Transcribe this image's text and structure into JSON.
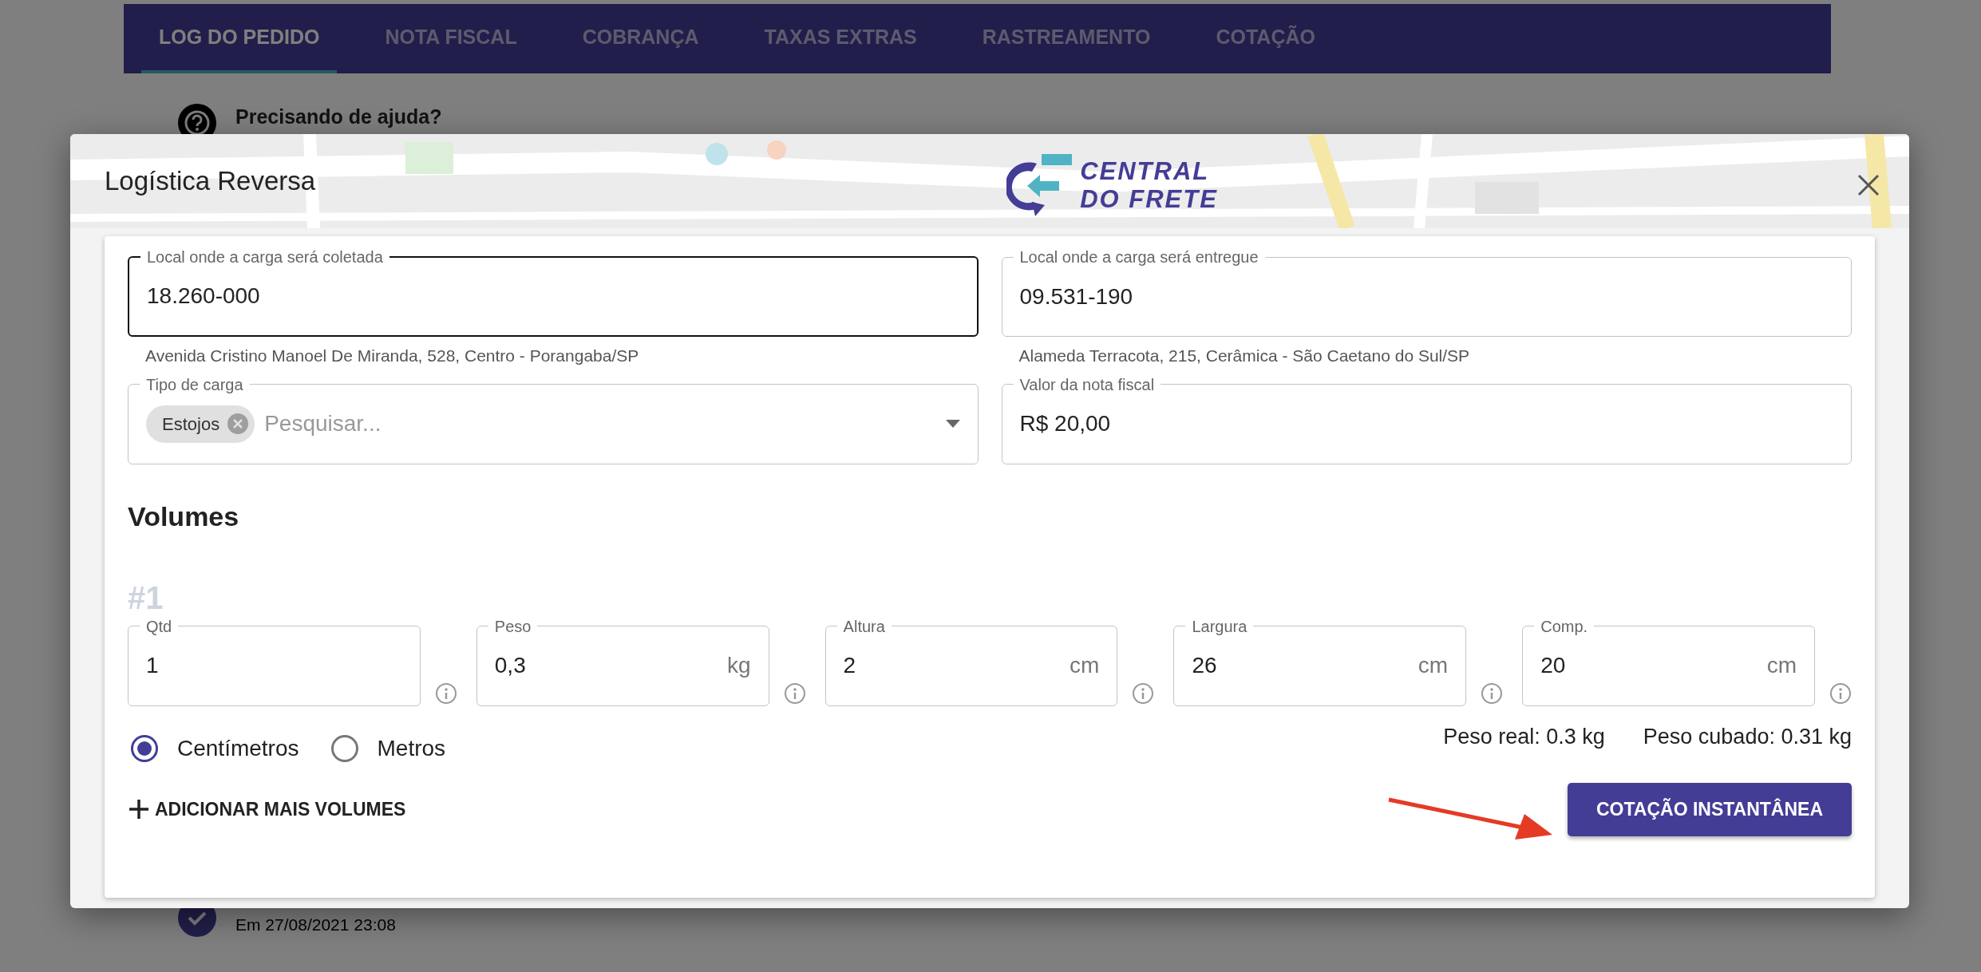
{
  "tabs": [
    {
      "label": "LOG DO PEDIDO",
      "selected": true
    },
    {
      "label": "NOTA FISCAL",
      "selected": false
    },
    {
      "label": "COBRANÇA",
      "selected": false
    },
    {
      "label": "TAXAS EXTRAS",
      "selected": false
    },
    {
      "label": "RASTREAMENTO",
      "selected": false
    },
    {
      "label": "COTAÇÃO",
      "selected": false
    }
  ],
  "help": {
    "title": "Precisando de ajuda?"
  },
  "timeline": [
    {
      "date": "Em 27/08/2021 23:08"
    }
  ],
  "dialog": {
    "title": "Logística Reversa",
    "logo": [
      "CENTRAL",
      "DO FRETE"
    ],
    "fields": [
      {
        "kind": "text",
        "label": "Local onde a carga será coletada",
        "value": "18.260-000",
        "helper": "Avenida Cristino Manoel De Miranda, 528, Centro - Porangaba/SP",
        "focused": true
      },
      {
        "kind": "text",
        "label": "Local onde a carga será entregue",
        "value": "09.531-190",
        "helper": "Alameda Terracota, 215, Cerâmica - São Caetano do Sul/SP",
        "focused": false
      },
      {
        "kind": "select",
        "label": "Tipo de carga",
        "chips": [
          "Estojos"
        ],
        "placeholder": "Pesquisar...",
        "focused": false
      },
      {
        "kind": "text",
        "label": "Valor da nota fiscal",
        "value": "R$ 20,00",
        "focused": false
      }
    ],
    "volumes_title": "Volumes",
    "volumes": [
      {
        "number": "#1",
        "fields": [
          {
            "label": "Qtd",
            "value": "1"
          },
          {
            "label": "Peso",
            "value": "0,3",
            "unit": "kg"
          },
          {
            "label": "Altura",
            "value": "2",
            "unit": "cm"
          },
          {
            "label": "Largura",
            "value": "26",
            "unit": "cm"
          },
          {
            "label": "Comp.",
            "value": "20",
            "unit": "cm"
          }
        ]
      }
    ],
    "units": [
      {
        "label": "Centímetros",
        "selected": true
      },
      {
        "label": "Metros",
        "selected": false
      }
    ],
    "totals": [
      "Peso real: 0.3 kg",
      "Peso cubado: 0.31 kg"
    ],
    "add_button": "ADICIONAR MAIS VOLUMES",
    "submit_button": "COTAÇÃO INSTANTÂNEA"
  }
}
